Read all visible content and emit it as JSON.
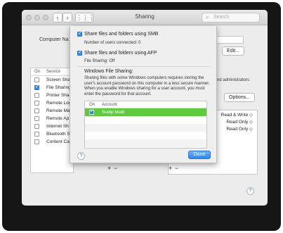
{
  "window": {
    "title": "Sharing",
    "search_placeholder": "Search",
    "nav_back": "‹",
    "nav_forward": "›",
    "grid_icon": "⋮⋮⋮"
  },
  "background": {
    "computer_name_label": "Computer Na",
    "edit_button": "Edit...",
    "admins_text": "nd administrators",
    "options_button": "Options...",
    "services_header_on": "On",
    "services_header_service": "Service",
    "services": [
      {
        "name": "Screen Shar",
        "on": false
      },
      {
        "name": "File Sharing",
        "on": true
      },
      {
        "name": "Printer Sha",
        "on": false
      },
      {
        "name": "Remote Log",
        "on": false
      },
      {
        "name": "Remote Ma",
        "on": false
      },
      {
        "name": "Remote Ap",
        "on": false
      },
      {
        "name": "Internet Sh",
        "on": false
      },
      {
        "name": "Bluetooth S",
        "on": false
      },
      {
        "name": "Content Ca",
        "on": false
      }
    ],
    "permissions": [
      "Read & Write ◇",
      "Read Only ◇",
      "Read Only ◇"
    ],
    "plus": "+",
    "minus": "−",
    "help": "?"
  },
  "sheet": {
    "smb_label": "Share files and folders using SMB",
    "smb_users": "Number of users connected: 0",
    "afp_label": "Share files and folders using AFP",
    "afp_status": "File Sharing: Off",
    "windows_heading": "Windows File Sharing:",
    "windows_desc": "Sharing files with some Windows computers requires storing the user's account password on this computer in a less secure manner. When you enable Windows sharing for a user account, you must enter the password for that account.",
    "table_header_on": "On",
    "table_header_account": "Account",
    "accounts": [
      {
        "name": "Sudip Maiti",
        "on": true
      }
    ],
    "help": "?",
    "done_button": "Done"
  }
}
